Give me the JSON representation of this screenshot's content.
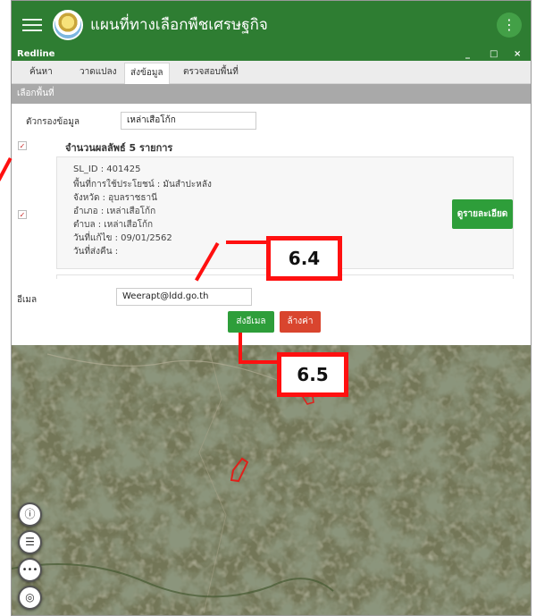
{
  "app": {
    "title": "แผนที่ทางเลือกพืชเศรษฐกิจ",
    "more_icon": "more-vertical-icon"
  },
  "window": {
    "title": "Redline",
    "controls": [
      "_",
      "□",
      "×"
    ]
  },
  "tabs": [
    {
      "label": "ค้นหา"
    },
    {
      "label": "วาดแปลง"
    },
    {
      "label": "ส่งข้อมูล",
      "active": true
    },
    {
      "label": "ตรวจสอบพื้นที่"
    }
  ],
  "section": {
    "title": "เลือกพื้นที่"
  },
  "filter": {
    "label": "ตัวกรองข้อมูล",
    "value": "เหล่าเสือโก้ก"
  },
  "results": {
    "count_text": "จำนวนผลลัพธ์ 5 รายการ"
  },
  "record": {
    "lines": [
      "SL_ID : 401425",
      "พื้นที่การใช้ประโยชน์ : มันสำปะหลัง",
      "จังหวัด : อุบลราชธานี",
      "อำเภอ : เหล่าเสือโก้ก",
      "ตำบล : เหล่าเสือโก้ก",
      "วันที่แก้ไข : 09/01/2562",
      "วันที่ส่งคืน :"
    ],
    "detail_button": "ดูรายละเอียด"
  },
  "email": {
    "label": "อีเมล",
    "value": "Weerapt@ldd.go.th"
  },
  "actions": {
    "send": "ส่งอีเมล",
    "clear": "ล้างค่า"
  },
  "callouts": {
    "a": "6.4",
    "b": "6.5"
  },
  "map_controls": {
    "info": "ⓘ",
    "list": "☰",
    "more": "•••",
    "locate": "◎"
  },
  "colors": {
    "primary_green": "#2e7d32",
    "button_green": "#2e9e3a",
    "clear_red": "#d9452e",
    "annotation_red": "#ff1010"
  }
}
